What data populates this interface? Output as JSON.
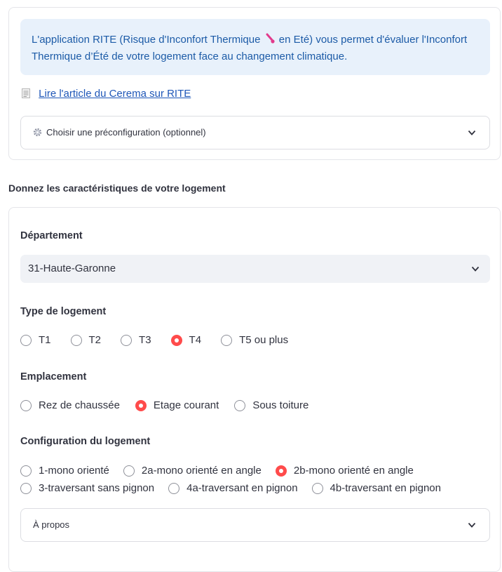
{
  "intro": {
    "text_before": "L'application RITE (Risque d'Inconfort Thermique",
    "text_after": "en Eté) vous permet d'évaluer l'Inconfort",
    "text_line2": "Thermique d’Été de votre logement face au changement climatique.",
    "icon": "thermometer-icon",
    "accent_color": "#1c5ba7",
    "background_color": "#e8f1fb"
  },
  "article_link": {
    "icon": "document-icon",
    "label": "Lire l'article du Cerema sur RITE"
  },
  "preconfig": {
    "icon": "gear-icon",
    "label": "Choisir une préconfiguration (optionnel)"
  },
  "section_heading": "Donnez les caractéristiques de votre logement",
  "departement": {
    "label": "Département",
    "selected": "31-Haute-Garonne"
  },
  "type_logement": {
    "label": "Type de logement",
    "options": [
      "T1",
      "T2",
      "T3",
      "T4",
      "T5 ou plus"
    ],
    "selected": "T4"
  },
  "emplacement": {
    "label": "Emplacement",
    "options": [
      "Rez de chaussée",
      "Etage courant",
      "Sous toiture"
    ],
    "selected": "Etage courant"
  },
  "configuration": {
    "label": "Configuration du logement",
    "options_row1": [
      "1-mono orienté",
      "2a-mono orienté en angle",
      "2b-mono orienté en angle"
    ],
    "options_row2": [
      "3-traversant sans pignon",
      "4a-traversant en pignon",
      "4b-traversant en pignon"
    ],
    "selected": "2b-mono orienté en angle"
  },
  "apropos": {
    "label": "À propos"
  },
  "colors": {
    "radio_selected": "#ff4b4b",
    "link": "#1f57b8"
  }
}
